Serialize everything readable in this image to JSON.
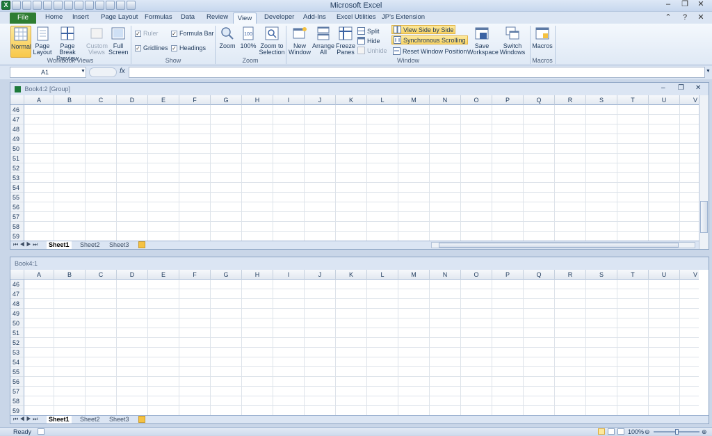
{
  "app": {
    "title": "Microsoft Excel"
  },
  "window_controls": {
    "minimize": "–",
    "maximize": "❐",
    "close": "✕"
  },
  "ribbon_tabs": [
    "File",
    "Home",
    "Insert",
    "Page Layout",
    "Formulas",
    "Data",
    "Review",
    "View",
    "Developer",
    "Add-Ins",
    "Excel Utilities",
    "JP's Extension"
  ],
  "ribbon": {
    "workbook_views": {
      "label": "Workbook Views",
      "normal": "Normal",
      "page_layout": "Page Layout",
      "page_break": "Page Break Preview",
      "custom_views": "Custom Views",
      "full_screen": "Full Screen"
    },
    "show": {
      "label": "Show",
      "ruler": "Ruler",
      "gridlines": "Gridlines",
      "formula_bar": "Formula Bar",
      "headings": "Headings"
    },
    "zoom": {
      "label": "Zoom",
      "zoom": "Zoom",
      "hundred": "100%",
      "zoom_selection": "Zoom to Selection"
    },
    "window": {
      "label": "Window",
      "new_window": "New Window",
      "arrange_all": "Arrange All",
      "freeze_panes": "Freeze Panes",
      "split": "Split",
      "hide": "Hide",
      "unhide": "Unhide",
      "side_by_side": "View Side by Side",
      "sync_scroll": "Synchronous Scrolling",
      "reset_pos": "Reset Window Position",
      "save_workspace": "Save Workspace",
      "switch_windows": "Switch Windows"
    },
    "macros": {
      "label": "Macros",
      "macros": "Macros"
    }
  },
  "formula_bar": {
    "name_box": "A1",
    "fx": "fx",
    "formula": ""
  },
  "pane_top": {
    "title": "Book4:2  [Group]"
  },
  "pane_bottom": {
    "title": "Book4:1"
  },
  "columns": [
    "A",
    "B",
    "C",
    "D",
    "E",
    "F",
    "G",
    "H",
    "I",
    "J",
    "K",
    "L",
    "M",
    "N",
    "O",
    "P",
    "Q",
    "R",
    "S",
    "T",
    "U",
    "V"
  ],
  "rows": [
    "46",
    "47",
    "48",
    "49",
    "50",
    "51",
    "52",
    "53",
    "54",
    "55",
    "56",
    "57",
    "58",
    "59"
  ],
  "sheet_tabs": [
    "Sheet1",
    "Sheet2",
    "Sheet3"
  ],
  "status": {
    "ready": "Ready",
    "zoom": "100%"
  }
}
